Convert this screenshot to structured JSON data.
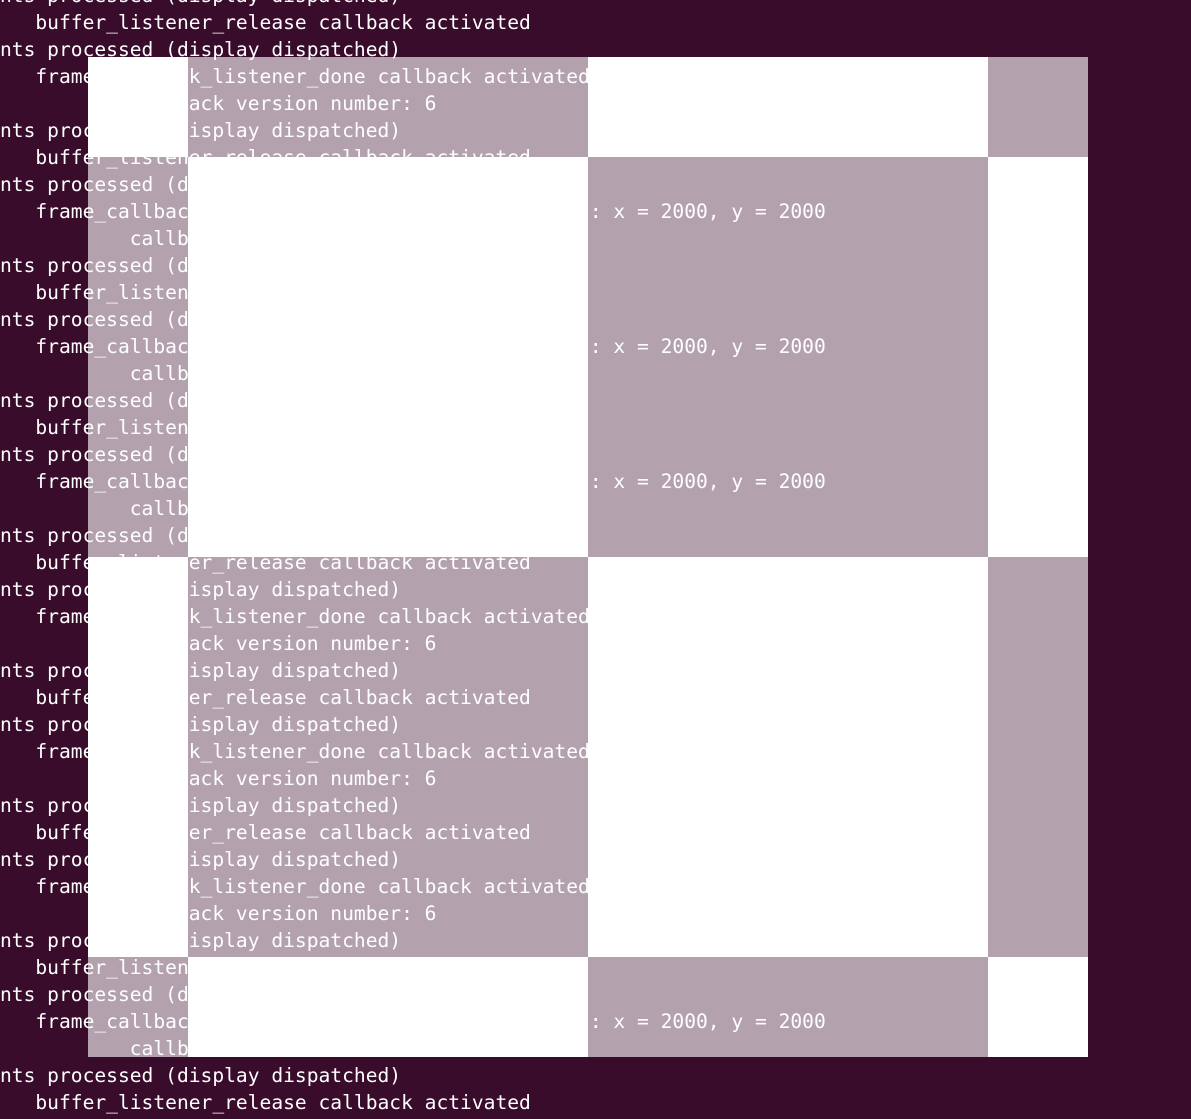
{
  "terminal": {
    "background": "#380c2a",
    "text_color": "#ffffff",
    "lines": [
      "nts processed (display dispatched)",
      "   buffer_listener_release callback activated",
      "nts processed (display dispatched)",
      "   frame_callback_listener_done callback activated",
      "           callback version number: 6",
      "nts processed (display dispatched)",
      "   buffer_listener_release callback activated",
      "nts processed (display dispatched)",
      "   frame_callback_listener_done callback activated: x = 2000, y = 2000",
      "           callback version number: 6",
      "nts processed (display dispatched)",
      "   buffer_listener_release callback activated",
      "nts processed (display dispatched)",
      "   frame_callback_listener_done callback activated: x = 2000, y = 2000",
      "           callback version number: 6",
      "nts processed (display dispatched)",
      "   buffer_listener_release callback activated",
      "nts processed (display dispatched)",
      "   frame_callback_listener_done callback activated: x = 2000, y = 2000",
      "           callback version number: 6",
      "nts processed (display dispatched)",
      "   buffer_listener_release callback activated",
      "nts processed (display dispatched)",
      "   frame_callback_listener_done callback activated",
      "           callback version number: 6",
      "nts processed (display dispatched)",
      "   buffer_listener_release callback activated",
      "nts processed (display dispatched)",
      "   frame_callback_listener_done callback activated",
      "           callback version number: 6",
      "nts processed (display dispatched)",
      "   buffer_listener_release callback activated",
      "nts processed (display dispatched)",
      "   frame_callback_listener_done callback activated",
      "           callback version number: 6",
      "nts processed (display dispatched)",
      "   buffer_listener_release callback activated",
      "nts processed (display dispatched)",
      "   frame_callback_listener_done callback activated: x = 2000, y = 2000",
      "           callback version number: 6",
      "nts processed (display dispatched)",
      "   buffer_listener_release callback activated"
    ]
  },
  "overlay": {
    "colors": {
      "opaque": "#ffffff",
      "translucent": "#b4a4ad"
    }
  }
}
